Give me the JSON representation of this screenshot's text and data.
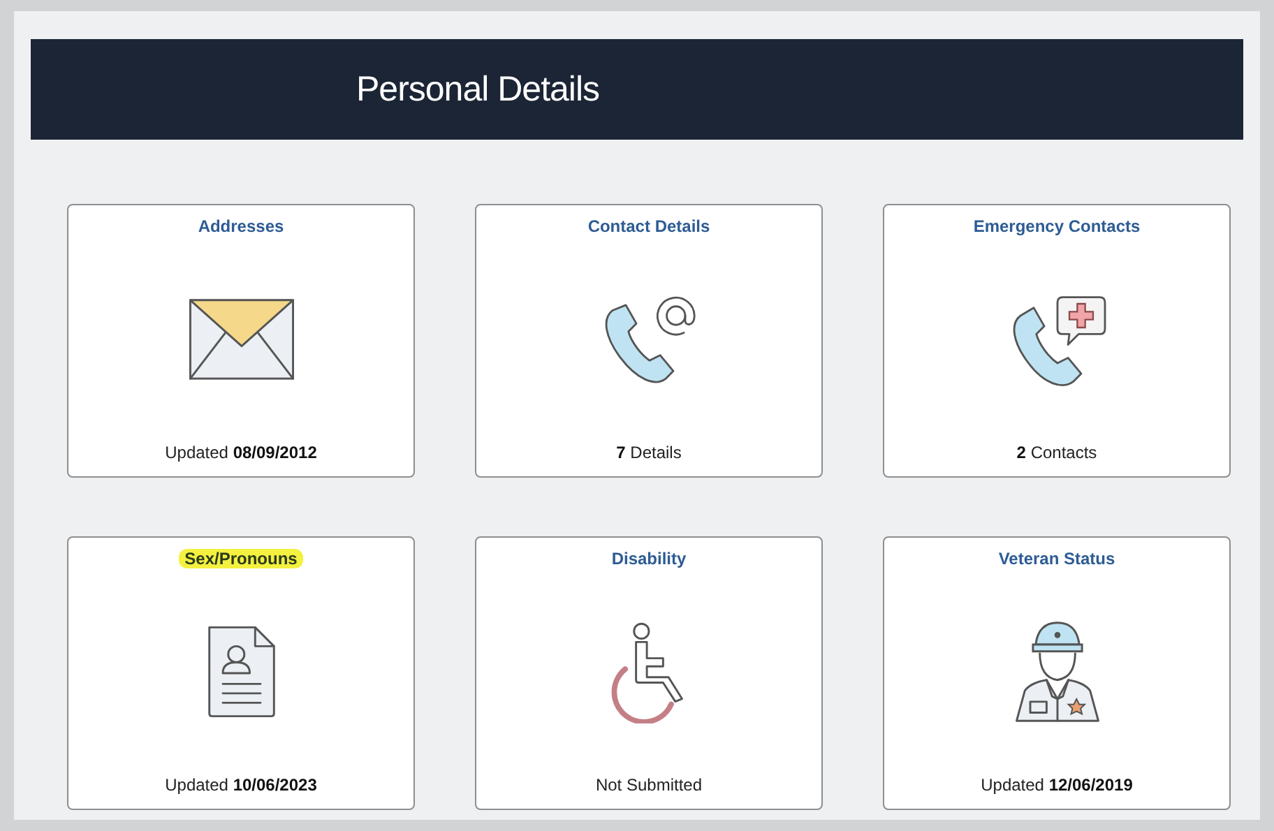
{
  "header": {
    "title": "Personal Details"
  },
  "tiles": [
    {
      "title": "Addresses",
      "highlighted": false,
      "kind": "envelope",
      "footer": "Updated **08/09/2012**"
    },
    {
      "title": "Contact Details",
      "highlighted": false,
      "kind": "phone-at",
      "footer": "**7** Details"
    },
    {
      "title": "Emergency Contacts",
      "highlighted": false,
      "kind": "phone-medical",
      "footer": "**2** Contacts"
    },
    {
      "title": "Sex/Pronouns",
      "highlighted": true,
      "kind": "document-person",
      "footer": "Updated **10/06/2023**"
    },
    {
      "title": "Disability",
      "highlighted": false,
      "kind": "wheelchair",
      "footer": "Not Submitted"
    },
    {
      "title": "Veteran Status",
      "highlighted": false,
      "kind": "officer",
      "footer": "Updated **12/06/2019**"
    }
  ]
}
